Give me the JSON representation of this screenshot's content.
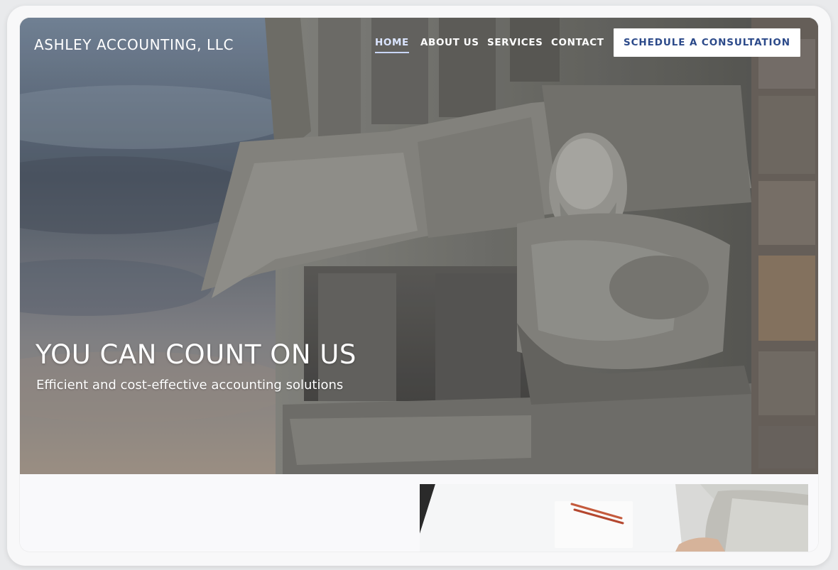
{
  "brand": {
    "name": "ASHLEY ACCOUNTING, LLC"
  },
  "nav": {
    "items": [
      {
        "label": "HOME",
        "active": true
      },
      {
        "label": "ABOUT US",
        "active": false
      },
      {
        "label": "SERVICES",
        "active": false
      },
      {
        "label": "CONTACT",
        "active": false
      }
    ],
    "cta_label": "SCHEDULE A CONSULTATION"
  },
  "hero": {
    "headline": "YOU CAN COUNT ON US",
    "subheadline": "Efficient and cost-effective accounting solutions"
  },
  "colors": {
    "accent": "#2c4a8a",
    "active_nav": "#dbe5ff"
  }
}
